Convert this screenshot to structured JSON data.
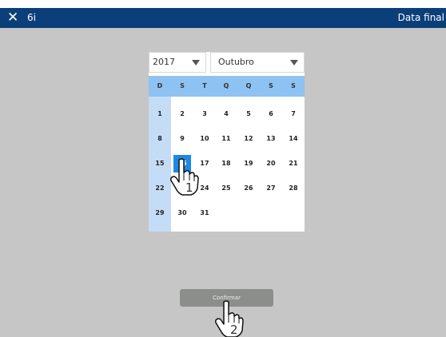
{
  "topbar": {
    "close_icon": "close-icon",
    "title_left": "6i",
    "title_right": "Data final"
  },
  "calendar": {
    "year": "2017",
    "month": "Outubro",
    "weekdays": [
      "D",
      "S",
      "T",
      "Q",
      "Q",
      "S",
      "S"
    ],
    "weeks": [
      [
        "1",
        "2",
        "3",
        "4",
        "5",
        "6",
        "7"
      ],
      [
        "8",
        "9",
        "10",
        "11",
        "12",
        "13",
        "14"
      ],
      [
        "15",
        "16",
        "17",
        "18",
        "19",
        "20",
        "21"
      ],
      [
        "22",
        "23",
        "24",
        "25",
        "26",
        "27",
        "28"
      ],
      [
        "29",
        "30",
        "31",
        "",
        "",
        "",
        ""
      ]
    ],
    "selected_day": "16",
    "colors": {
      "header": "#8ec2f2",
      "sunday_column": "#c5dcf6",
      "selected": "#1e88e5"
    }
  },
  "confirm_button": {
    "label": "Confirmar"
  },
  "overlays": {
    "hand_icon": "hand-pointer-icon",
    "step_1": "1",
    "step_2": "2"
  },
  "colors": {
    "topbar": "#0b3f7a",
    "background": "#c6c6c6",
    "button": "#8c8e8c"
  }
}
